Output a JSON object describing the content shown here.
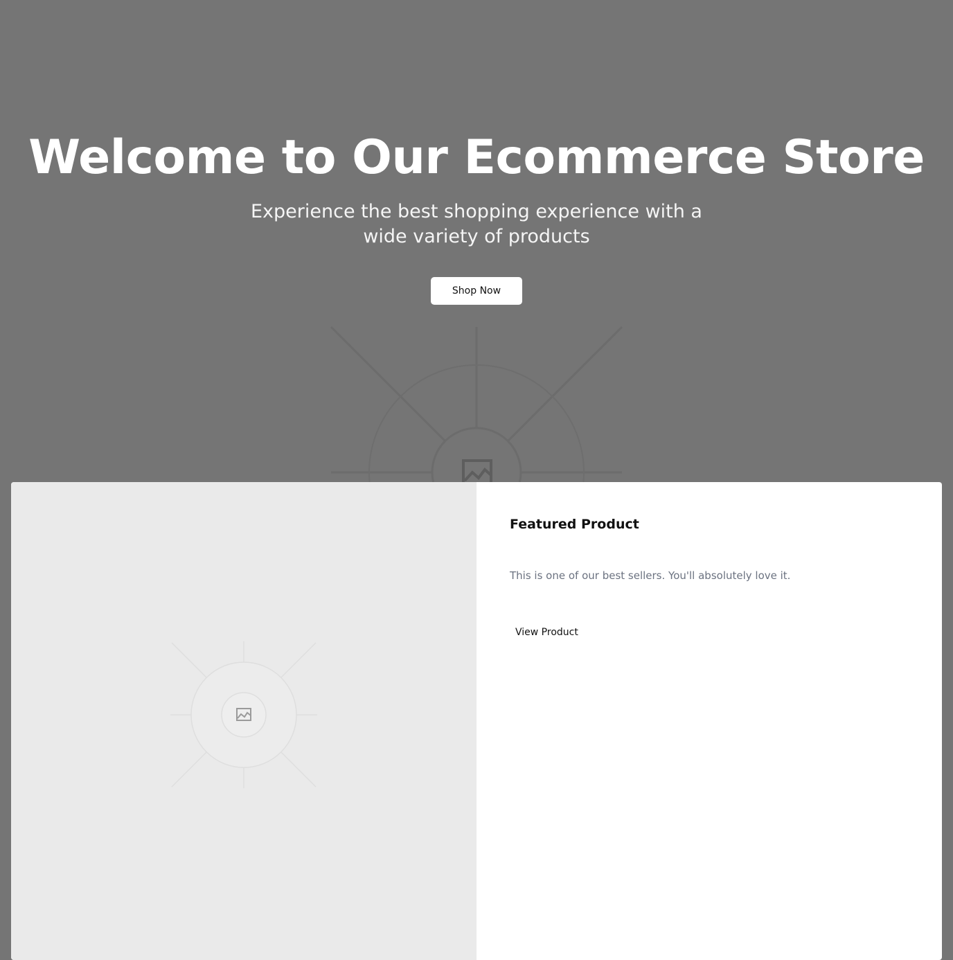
{
  "hero": {
    "title": "Welcome to Our Ecommerce Store",
    "subtitle": "Experience the best shopping experience with a wide variety of products",
    "cta_label": "Shop Now"
  },
  "featured": {
    "title": "Featured Product",
    "description": "This is one of our best sellers. You'll absolutely love it.",
    "cta_label": "View Product"
  },
  "icons": {
    "hero_image": "image-placeholder-icon",
    "product_image": "image-placeholder-icon"
  },
  "colors": {
    "hero_background": "#757575",
    "card_image_background": "#eaeaea",
    "description_text": "#6b7280"
  }
}
